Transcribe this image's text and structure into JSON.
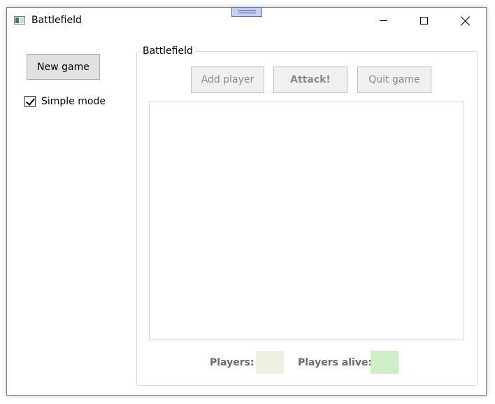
{
  "window": {
    "title": "Battlefield",
    "icon": "app-window-icon"
  },
  "titlebar": {
    "controls": [
      "minimize-icon",
      "maximize-icon",
      "close-icon"
    ]
  },
  "sidebar": {
    "new_game_label": "New game",
    "simple_mode_label": "Simple mode",
    "simple_mode_checked": true
  },
  "battlefield": {
    "group_title": "Battlefield",
    "add_player_label": "Add player",
    "attack_label": "Attack!",
    "quit_game_label": "Quit game",
    "players_label": "Players:",
    "players_alive_label": "Players alive:"
  },
  "colors": {
    "players_swatch": "#f0f0e2",
    "players_alive_swatch": "#cdeec7",
    "drag_handle": "#c7d0ef"
  }
}
